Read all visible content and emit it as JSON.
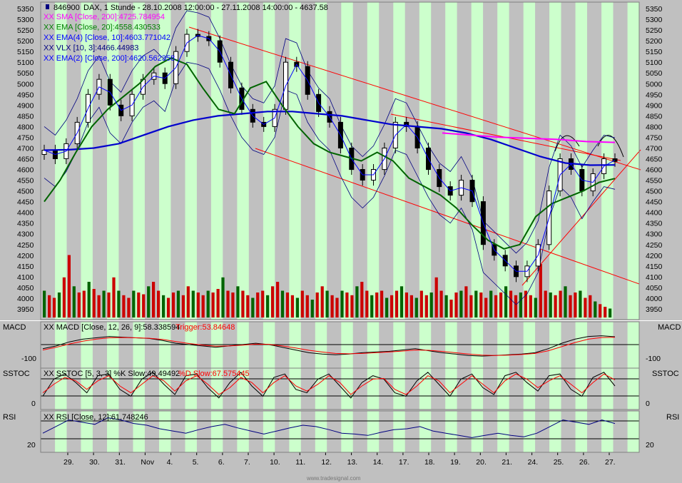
{
  "chart_data": {
    "type": "candlestick",
    "symbol": "846900",
    "title": "DAX, 1 Stunde - 28.10.2008 12:00:00 - 27.11.2008 14:00:00 - 4637.58",
    "price_ylim": [
      3900,
      5380
    ],
    "price_ticks": [
      3950,
      4000,
      4050,
      4100,
      4150,
      4200,
      4250,
      4300,
      4350,
      4400,
      4450,
      4500,
      4550,
      4600,
      4650,
      4700,
      4750,
      4800,
      4850,
      4900,
      4950,
      5000,
      5050,
      5100,
      5150,
      5200,
      5250,
      5300,
      5350
    ],
    "x_tick_labels": [
      "29.",
      "30.",
      "31.",
      "Nov",
      "4.",
      "5.",
      "6.",
      "7.",
      "10.",
      "11.",
      "12.",
      "13.",
      "14.",
      "17.",
      "18.",
      "19.",
      "20.",
      "21.",
      "24.",
      "25.",
      "26.",
      "27."
    ],
    "session_count": 23,
    "legend": [
      {
        "text": "XX SMA [Close, 200]:4725.784954",
        "color": "#ff00ff"
      },
      {
        "text": "XX EMA [Close, 20]:4558.430533",
        "color": "#008000"
      },
      {
        "text": "XX EMA(4) [Close, 10]:4603.771042",
        "color": "#0000ff"
      },
      {
        "text": "XX VLX [10, 3]:4466.44983",
        "color": "#000080"
      },
      {
        "text": "XX EMA(2) [Close, 200]:4620.562358",
        "color": "#0000ff"
      }
    ],
    "series": [
      {
        "name": "Close",
        "values": [
          4690,
          4650,
          4720,
          4820,
          4950,
          5020,
          4900,
          4850,
          4950,
          5020,
          5050,
          5000,
          5150,
          5230,
          5220,
          5200,
          5100,
          4980,
          4880,
          4820,
          4800,
          4880,
          5100,
          5080,
          4950,
          4870,
          4820,
          4700,
          4600,
          4550,
          4600,
          4700,
          4820,
          4800,
          4700,
          4600,
          4520,
          4480,
          4550,
          4450,
          4250,
          4200,
          4150,
          4100,
          4150,
          4250,
          4500,
          4650,
          4600,
          4500,
          4580,
          4650,
          4637.58
        ]
      },
      {
        "name": "XX SMA [Close, 200]",
        "values": [
          4770,
          4760,
          4750,
          4745,
          4740,
          4730,
          4726
        ]
      },
      {
        "name": "XX EMA [Close, 20]",
        "values": [
          4450,
          4550,
          4680,
          4800,
          4880,
          4940,
          5000,
          5080,
          5120,
          5090,
          4980,
          4880,
          4860,
          4980,
          5010,
          4900,
          4800,
          4720,
          4680,
          4660,
          4640,
          4680,
          4640,
          4560,
          4520,
          4480,
          4420,
          4340,
          4270,
          4230,
          4250,
          4380,
          4440,
          4470,
          4500,
          4540,
          4558
        ]
      },
      {
        "name": "XX EMA(2) [Close, 200]",
        "values": [
          4690,
          4692,
          4700,
          4720,
          4760,
          4800,
          4830,
          4850,
          4860,
          4870,
          4870,
          4860,
          4850,
          4830,
          4810,
          4800,
          4790,
          4770,
          4740,
          4700,
          4660,
          4630,
          4620,
          4621
        ]
      }
    ],
    "volume_values": [
      30,
      25,
      22,
      28,
      45,
      70,
      35,
      28,
      30,
      40,
      32,
      25,
      30,
      28,
      45,
      30,
      25,
      22,
      30,
      28,
      26,
      35,
      40,
      30,
      25,
      22,
      28,
      30,
      25,
      35,
      30,
      28,
      25,
      30,
      28,
      32,
      45,
      30,
      28,
      35,
      30,
      25,
      22,
      28,
      30,
      25,
      35,
      40,
      30,
      28,
      25,
      22,
      30,
      25,
      20,
      28,
      35,
      30,
      25,
      22,
      30,
      28,
      25,
      35,
      40,
      30,
      25,
      28,
      30,
      22,
      25,
      30,
      35,
      28,
      25,
      22,
      30,
      25,
      28,
      45,
      30,
      25,
      20,
      28,
      30,
      35,
      25,
      30,
      28,
      22,
      30,
      25,
      28,
      35,
      30,
      25,
      28,
      30,
      25,
      22,
      60,
      30,
      28,
      25,
      30,
      35,
      25,
      28,
      30,
      22,
      25,
      18,
      15,
      12,
      10
    ],
    "macd": {
      "label": "MACD",
      "legend": "XX MACD [Close, 12, 26, 9]:58.338594",
      "trigger": "Trigger:53.84648",
      "ticks": [
        "-100"
      ],
      "macd_values": [
        -30,
        -10,
        20,
        40,
        50,
        60,
        55,
        50,
        45,
        30,
        10,
        0,
        -10,
        -20,
        -10,
        0,
        10,
        0,
        -20,
        -40,
        -60,
        -70,
        -75,
        -70,
        -60,
        -55,
        -50,
        -40,
        -30,
        -45,
        -60,
        -70,
        -80,
        -85,
        -80,
        -75,
        -70,
        -60,
        -30,
        10,
        40,
        60,
        65,
        58
      ],
      "trigger_values": [
        -40,
        -20,
        5,
        25,
        40,
        50,
        52,
        50,
        47,
        38,
        22,
        8,
        -3,
        -12,
        -10,
        -4,
        3,
        2,
        -10,
        -25,
        -42,
        -55,
        -65,
        -68,
        -65,
        -60,
        -55,
        -48,
        -40,
        -42,
        -50,
        -60,
        -70,
        -78,
        -80,
        -78,
        -73,
        -65,
        -45,
        -15,
        15,
        40,
        52,
        54
      ]
    },
    "sstoc": {
      "label": "SSTOC",
      "legend": "XX SSTOC [5, 3, 3] %K Slow:49.49492",
      "d_legend": "%D Slow:67.575445",
      "ticks": [
        "0"
      ],
      "k_values": [
        20,
        70,
        85,
        60,
        30,
        80,
        85,
        40,
        20,
        70,
        90,
        55,
        25,
        80,
        85,
        45,
        15,
        60,
        90,
        50,
        20,
        75,
        85,
        40,
        30,
        70,
        85,
        50,
        15,
        60,
        80,
        70,
        30,
        20,
        65,
        90,
        55,
        20,
        70,
        85,
        45,
        25,
        80,
        90,
        60,
        35,
        80,
        85,
        40,
        20,
        75,
        90,
        50
      ],
      "d_values": [
        30,
        55,
        75,
        65,
        40,
        65,
        80,
        50,
        30,
        55,
        80,
        65,
        35,
        65,
        80,
        55,
        25,
        45,
        75,
        60,
        30,
        60,
        80,
        50,
        35,
        55,
        80,
        60,
        25,
        50,
        70,
        72,
        40,
        25,
        50,
        80,
        65,
        30,
        55,
        80,
        55,
        30,
        65,
        85,
        70,
        45,
        65,
        80,
        55,
        30,
        60,
        85,
        68
      ]
    },
    "rsi": {
      "label": "RSI",
      "legend": "XX RSI [Close, 12]:61.748246",
      "ticks": [
        "20"
      ],
      "values": [
        40,
        55,
        70,
        65,
        60,
        75,
        70,
        62,
        58,
        50,
        45,
        40,
        48,
        55,
        60,
        52,
        45,
        38,
        45,
        52,
        58,
        55,
        48,
        40,
        38,
        35,
        42,
        48,
        50,
        55,
        45,
        40,
        35,
        30,
        35,
        40,
        35,
        32,
        40,
        55,
        70,
        65,
        60,
        70,
        62
      ]
    },
    "watermark": "www.tradesignal.com"
  }
}
